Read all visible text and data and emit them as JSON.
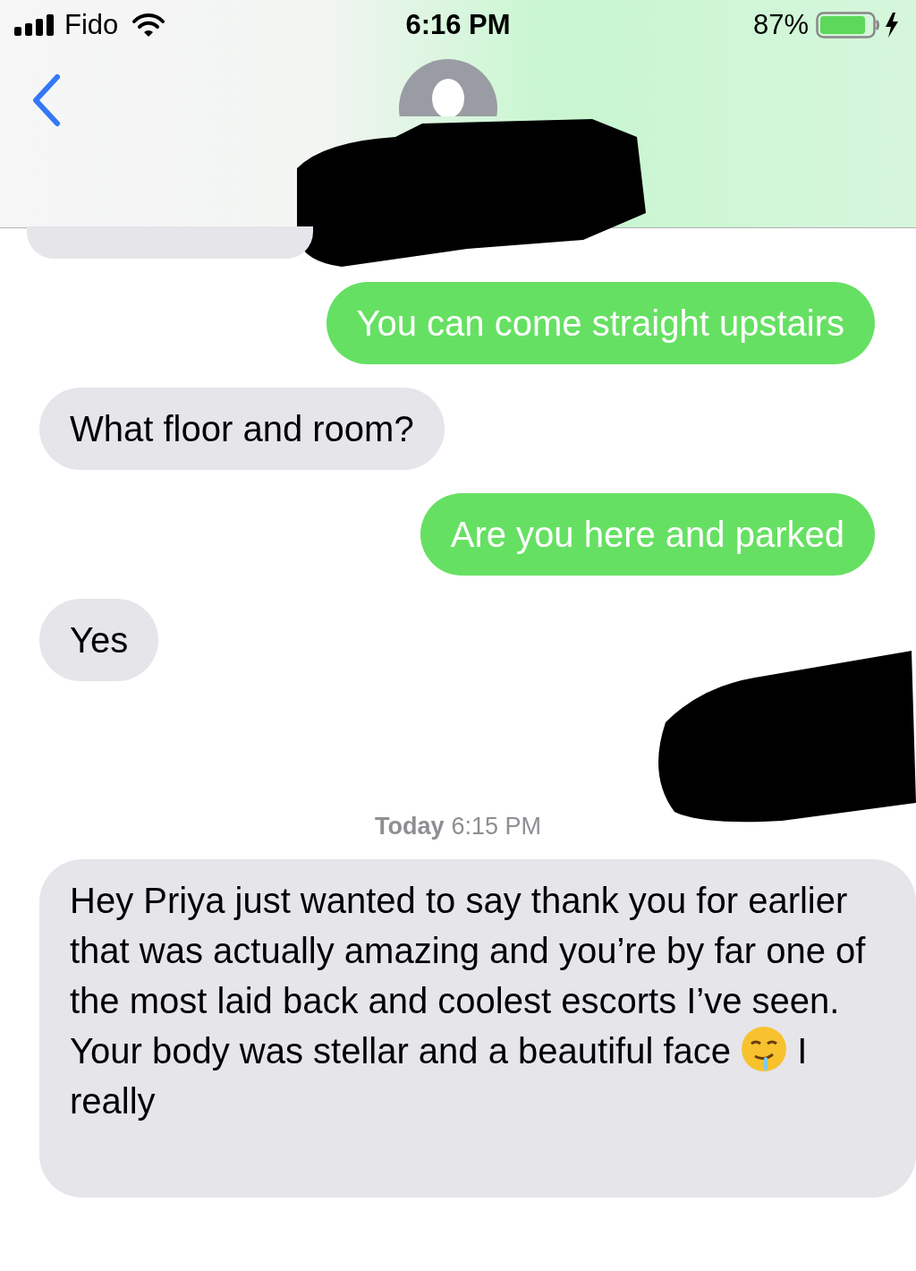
{
  "status_bar": {
    "carrier": "Fido",
    "time": "6:16 PM",
    "battery": "87%"
  },
  "messages": [
    {
      "kind": "cut"
    },
    {
      "kind": "sent",
      "text": "You can come straight upstairs"
    },
    {
      "kind": "received",
      "text": "What floor and room?"
    },
    {
      "kind": "sent",
      "text": "Are you here and parked"
    },
    {
      "kind": "received",
      "text": "Yes"
    },
    {
      "kind": "redacted"
    },
    {
      "kind": "timestamp",
      "day": "Today",
      "time": "6:15 PM"
    },
    {
      "kind": "received",
      "text": "Hey Priya just wanted to say thank you for earlier that was actually amazing and you’re by far one of the most laid back and coolest escorts I’ve seen. Your body was stellar and a beautiful face",
      "text_after": "I really"
    }
  ]
}
